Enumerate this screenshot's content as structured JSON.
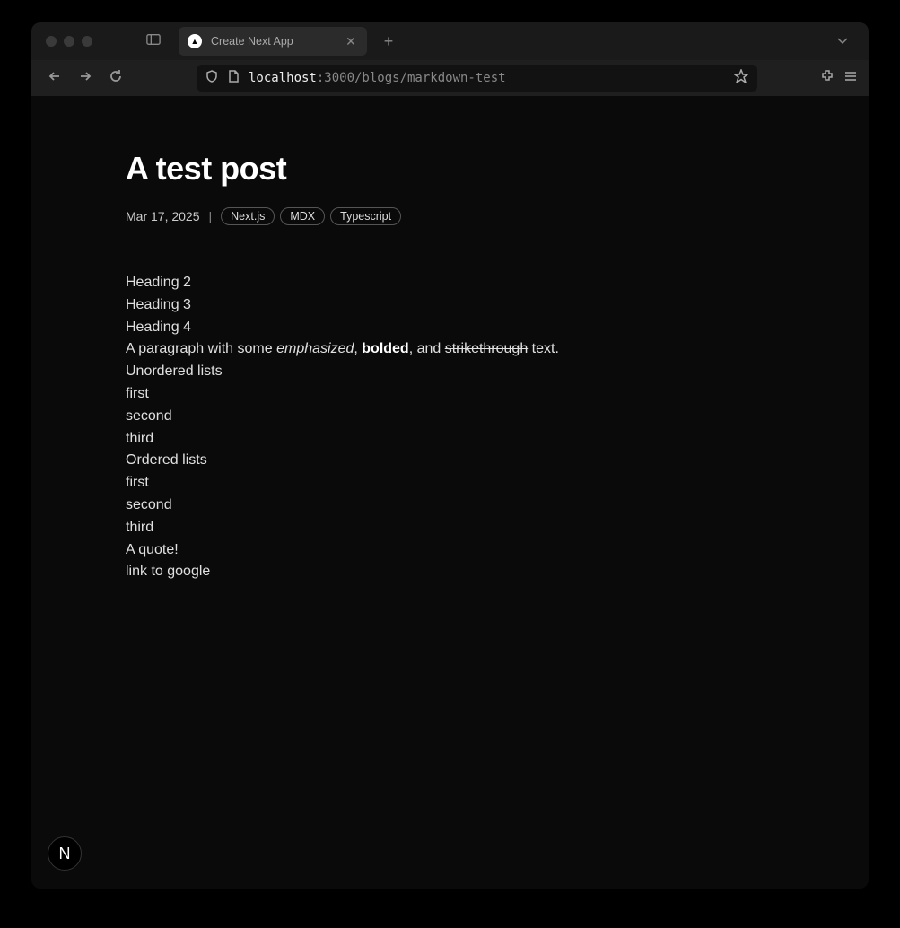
{
  "browser": {
    "tab": {
      "title": "Create Next App",
      "favicon": "▲"
    },
    "url": {
      "host": "localhost",
      "path": ":3000/blogs/markdown-test"
    }
  },
  "post": {
    "title": "A test post",
    "date": "Mar 17, 2025",
    "meta_separator": "|",
    "tags": [
      "Next.js",
      "MDX",
      "Typescript"
    ],
    "body": {
      "h2": "Heading 2",
      "h3": "Heading 3",
      "h4": "Heading 4",
      "paragraph": {
        "prefix": "A paragraph with some ",
        "em": "emphasized",
        "sep1": ", ",
        "bold": "bolded",
        "sep2": ", and ",
        "strike": "strikethrough",
        "suffix": " text."
      },
      "unordered_label": "Unordered lists",
      "unordered_items": [
        "first",
        "second",
        "third"
      ],
      "ordered_label": "Ordered lists",
      "ordered_items": [
        "first",
        "second",
        "third"
      ],
      "quote": "A quote!",
      "link": "link to google"
    }
  },
  "badge": {
    "label": "N"
  }
}
